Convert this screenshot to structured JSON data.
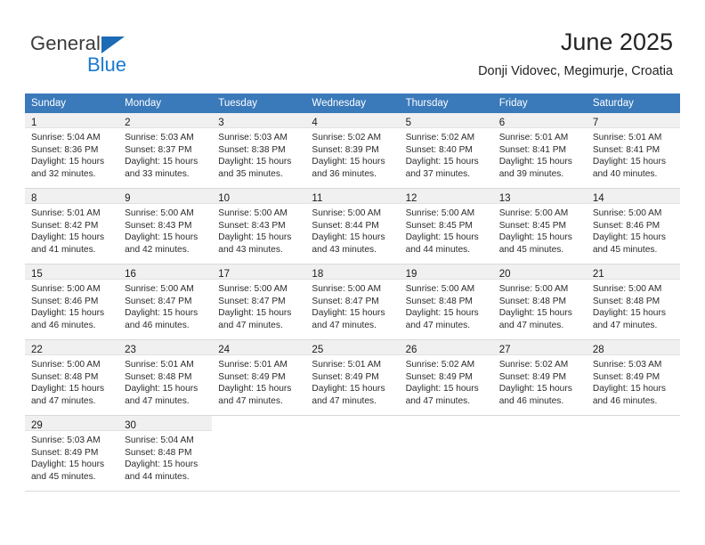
{
  "brand": {
    "name_part1": "General",
    "name_part2": "Blue",
    "triangle_color": "#1b6cb5",
    "blue_text_color": "#1b7ad0"
  },
  "header": {
    "title": "June 2025",
    "subtitle": "Donji Vidovec, Megimurje, Croatia"
  },
  "colors": {
    "header_blue": "#3a79ba",
    "daynum_band": "#f0f0f0",
    "grid_line": "#d9d9d9"
  },
  "weekdays": [
    "Sunday",
    "Monday",
    "Tuesday",
    "Wednesday",
    "Thursday",
    "Friday",
    "Saturday"
  ],
  "weeks": [
    [
      {
        "day": "1",
        "sunrise": "Sunrise: 5:04 AM",
        "sunset": "Sunset: 8:36 PM",
        "daylight1": "Daylight: 15 hours",
        "daylight2": "and 32 minutes."
      },
      {
        "day": "2",
        "sunrise": "Sunrise: 5:03 AM",
        "sunset": "Sunset: 8:37 PM",
        "daylight1": "Daylight: 15 hours",
        "daylight2": "and 33 minutes."
      },
      {
        "day": "3",
        "sunrise": "Sunrise: 5:03 AM",
        "sunset": "Sunset: 8:38 PM",
        "daylight1": "Daylight: 15 hours",
        "daylight2": "and 35 minutes."
      },
      {
        "day": "4",
        "sunrise": "Sunrise: 5:02 AM",
        "sunset": "Sunset: 8:39 PM",
        "daylight1": "Daylight: 15 hours",
        "daylight2": "and 36 minutes."
      },
      {
        "day": "5",
        "sunrise": "Sunrise: 5:02 AM",
        "sunset": "Sunset: 8:40 PM",
        "daylight1": "Daylight: 15 hours",
        "daylight2": "and 37 minutes."
      },
      {
        "day": "6",
        "sunrise": "Sunrise: 5:01 AM",
        "sunset": "Sunset: 8:41 PM",
        "daylight1": "Daylight: 15 hours",
        "daylight2": "and 39 minutes."
      },
      {
        "day": "7",
        "sunrise": "Sunrise: 5:01 AM",
        "sunset": "Sunset: 8:41 PM",
        "daylight1": "Daylight: 15 hours",
        "daylight2": "and 40 minutes."
      }
    ],
    [
      {
        "day": "8",
        "sunrise": "Sunrise: 5:01 AM",
        "sunset": "Sunset: 8:42 PM",
        "daylight1": "Daylight: 15 hours",
        "daylight2": "and 41 minutes."
      },
      {
        "day": "9",
        "sunrise": "Sunrise: 5:00 AM",
        "sunset": "Sunset: 8:43 PM",
        "daylight1": "Daylight: 15 hours",
        "daylight2": "and 42 minutes."
      },
      {
        "day": "10",
        "sunrise": "Sunrise: 5:00 AM",
        "sunset": "Sunset: 8:43 PM",
        "daylight1": "Daylight: 15 hours",
        "daylight2": "and 43 minutes."
      },
      {
        "day": "11",
        "sunrise": "Sunrise: 5:00 AM",
        "sunset": "Sunset: 8:44 PM",
        "daylight1": "Daylight: 15 hours",
        "daylight2": "and 43 minutes."
      },
      {
        "day": "12",
        "sunrise": "Sunrise: 5:00 AM",
        "sunset": "Sunset: 8:45 PM",
        "daylight1": "Daylight: 15 hours",
        "daylight2": "and 44 minutes."
      },
      {
        "day": "13",
        "sunrise": "Sunrise: 5:00 AM",
        "sunset": "Sunset: 8:45 PM",
        "daylight1": "Daylight: 15 hours",
        "daylight2": "and 45 minutes."
      },
      {
        "day": "14",
        "sunrise": "Sunrise: 5:00 AM",
        "sunset": "Sunset: 8:46 PM",
        "daylight1": "Daylight: 15 hours",
        "daylight2": "and 45 minutes."
      }
    ],
    [
      {
        "day": "15",
        "sunrise": "Sunrise: 5:00 AM",
        "sunset": "Sunset: 8:46 PM",
        "daylight1": "Daylight: 15 hours",
        "daylight2": "and 46 minutes."
      },
      {
        "day": "16",
        "sunrise": "Sunrise: 5:00 AM",
        "sunset": "Sunset: 8:47 PM",
        "daylight1": "Daylight: 15 hours",
        "daylight2": "and 46 minutes."
      },
      {
        "day": "17",
        "sunrise": "Sunrise: 5:00 AM",
        "sunset": "Sunset: 8:47 PM",
        "daylight1": "Daylight: 15 hours",
        "daylight2": "and 47 minutes."
      },
      {
        "day": "18",
        "sunrise": "Sunrise: 5:00 AM",
        "sunset": "Sunset: 8:47 PM",
        "daylight1": "Daylight: 15 hours",
        "daylight2": "and 47 minutes."
      },
      {
        "day": "19",
        "sunrise": "Sunrise: 5:00 AM",
        "sunset": "Sunset: 8:48 PM",
        "daylight1": "Daylight: 15 hours",
        "daylight2": "and 47 minutes."
      },
      {
        "day": "20",
        "sunrise": "Sunrise: 5:00 AM",
        "sunset": "Sunset: 8:48 PM",
        "daylight1": "Daylight: 15 hours",
        "daylight2": "and 47 minutes."
      },
      {
        "day": "21",
        "sunrise": "Sunrise: 5:00 AM",
        "sunset": "Sunset: 8:48 PM",
        "daylight1": "Daylight: 15 hours",
        "daylight2": "and 47 minutes."
      }
    ],
    [
      {
        "day": "22",
        "sunrise": "Sunrise: 5:00 AM",
        "sunset": "Sunset: 8:48 PM",
        "daylight1": "Daylight: 15 hours",
        "daylight2": "and 47 minutes."
      },
      {
        "day": "23",
        "sunrise": "Sunrise: 5:01 AM",
        "sunset": "Sunset: 8:48 PM",
        "daylight1": "Daylight: 15 hours",
        "daylight2": "and 47 minutes."
      },
      {
        "day": "24",
        "sunrise": "Sunrise: 5:01 AM",
        "sunset": "Sunset: 8:49 PM",
        "daylight1": "Daylight: 15 hours",
        "daylight2": "and 47 minutes."
      },
      {
        "day": "25",
        "sunrise": "Sunrise: 5:01 AM",
        "sunset": "Sunset: 8:49 PM",
        "daylight1": "Daylight: 15 hours",
        "daylight2": "and 47 minutes."
      },
      {
        "day": "26",
        "sunrise": "Sunrise: 5:02 AM",
        "sunset": "Sunset: 8:49 PM",
        "daylight1": "Daylight: 15 hours",
        "daylight2": "and 47 minutes."
      },
      {
        "day": "27",
        "sunrise": "Sunrise: 5:02 AM",
        "sunset": "Sunset: 8:49 PM",
        "daylight1": "Daylight: 15 hours",
        "daylight2": "and 46 minutes."
      },
      {
        "day": "28",
        "sunrise": "Sunrise: 5:03 AM",
        "sunset": "Sunset: 8:49 PM",
        "daylight1": "Daylight: 15 hours",
        "daylight2": "and 46 minutes."
      }
    ],
    [
      {
        "day": "29",
        "sunrise": "Sunrise: 5:03 AM",
        "sunset": "Sunset: 8:49 PM",
        "daylight1": "Daylight: 15 hours",
        "daylight2": "and 45 minutes."
      },
      {
        "day": "30",
        "sunrise": "Sunrise: 5:04 AM",
        "sunset": "Sunset: 8:48 PM",
        "daylight1": "Daylight: 15 hours",
        "daylight2": "and 44 minutes."
      },
      {
        "day": "",
        "sunrise": "",
        "sunset": "",
        "daylight1": "",
        "daylight2": ""
      },
      {
        "day": "",
        "sunrise": "",
        "sunset": "",
        "daylight1": "",
        "daylight2": ""
      },
      {
        "day": "",
        "sunrise": "",
        "sunset": "",
        "daylight1": "",
        "daylight2": ""
      },
      {
        "day": "",
        "sunrise": "",
        "sunset": "",
        "daylight1": "",
        "daylight2": ""
      },
      {
        "day": "",
        "sunrise": "",
        "sunset": "",
        "daylight1": "",
        "daylight2": ""
      }
    ]
  ]
}
